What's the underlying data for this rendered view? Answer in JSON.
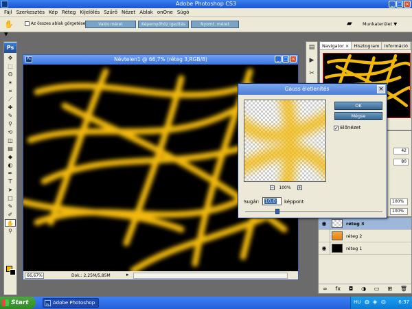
{
  "app": {
    "title": "Adobe Photoshop CS3",
    "window_buttons": [
      "_",
      "□",
      "×"
    ]
  },
  "menu": [
    "Fájl",
    "Szerkesztés",
    "Kép",
    "Réteg",
    "Kijelölés",
    "Szűrő",
    "Nézet",
    "Ablak",
    "onOne",
    "Súgó"
  ],
  "options": {
    "scroll_all_label": "Az összes ablak görgetése",
    "actual_pixels": "Valós méret",
    "fit_screen": "Képernyőhöz igazítás",
    "print_size": "Nyomt. méret",
    "workspace": "Munkaterület ▼"
  },
  "tools": {
    "logo": "Ps",
    "icons": [
      "move-icon",
      "marquee-icon",
      "lasso-icon",
      "magic-wand-icon",
      "crop-icon",
      "slice-icon",
      "healing-icon",
      "brush-icon",
      "stamp-icon",
      "history-brush-icon",
      "eraser-icon",
      "gradient-icon",
      "blur-icon",
      "dodge-icon",
      "pen-icon",
      "type-icon",
      "path-select-icon",
      "shape-icon",
      "notes-icon",
      "eyedropper-icon",
      "hand-icon",
      "zoom-icon"
    ],
    "glyphs": [
      "✥",
      "⬚",
      "ʘ",
      "✶",
      "⌗",
      "⟋",
      "✚",
      "✎",
      "⚲",
      "⟲",
      "◫",
      "▤",
      "◆",
      "◐",
      "✒",
      "T",
      "➤",
      "□",
      "✎",
      "✐",
      "✋",
      "⚲"
    ],
    "active_index": 20,
    "fg_color": "#f2b90c",
    "bg_color": "#000000"
  },
  "document": {
    "title": "Névtelen1 @ 66,7% (réteg 3,RGB/8)",
    "zoom": "66,67%",
    "info": "Dok.: 2,25M/5,85M"
  },
  "navigator": {
    "tabs": [
      "Navigator ×",
      "Hisztogram",
      "Információ"
    ]
  },
  "right_values": {
    "v1": "42",
    "v2": "80",
    "opacity": "100%",
    "fill": "100%"
  },
  "layers": [
    {
      "name": "réteg 3",
      "selected": true,
      "visible": true,
      "thumb": "checker"
    },
    {
      "name": "réteg 2",
      "selected": false,
      "visible": false,
      "thumb": "orange"
    },
    {
      "name": "réteg 1",
      "selected": false,
      "visible": true,
      "thumb": "black"
    }
  ],
  "layer_footer_icons": [
    "link-icon",
    "fx-icon",
    "mask-icon",
    "adjustment-icon",
    "folder-icon",
    "new-layer-icon",
    "trash-icon"
  ],
  "layer_footer_glyphs": [
    "∞",
    "fx",
    "◘",
    "◑",
    "▭",
    "⊞",
    "🗑"
  ],
  "gauss": {
    "title": "Gauss életlenítés",
    "ok": "OK",
    "cancel": "Mégse",
    "preview_label": "Előnézet",
    "preview_checked": true,
    "zoom_minus": "−",
    "zoom_value": "100%",
    "zoom_plus": "+",
    "radius_label": "Sugár:",
    "radius_value": "10,0",
    "radius_unit": "képpont",
    "slider_level": 0.22
  },
  "taskbar": {
    "start": "Start",
    "task_label": "Adobe Photoshop CS3",
    "lang": "HU",
    "clock": "6:37"
  },
  "colors": {
    "stroke_yellow": "#f2b90c",
    "titlebar_blue": "#2e6be0"
  }
}
